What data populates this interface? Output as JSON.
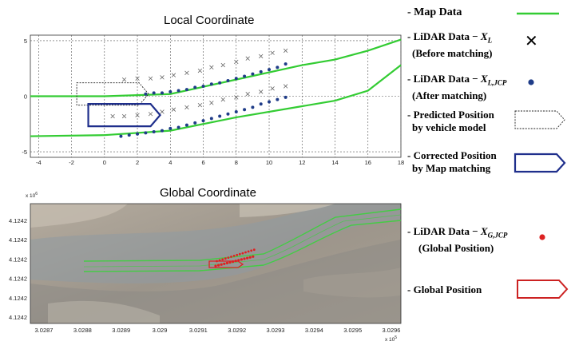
{
  "chart_data": [
    {
      "type": "line",
      "title": "Local Coordinate",
      "xlim": [
        -4.5,
        18
      ],
      "ylim": [
        -5.5,
        5.5
      ],
      "x_ticks": [
        -4,
        -2,
        0,
        2,
        4,
        6,
        8,
        10,
        12,
        14,
        16,
        18
      ],
      "y_ticks": [
        5,
        0,
        -5
      ],
      "grid": true,
      "series": [
        {
          "name": "Map Data",
          "style": "line",
          "color": "#33cc33",
          "lines": [
            [
              [
                -4.5,
                0.0
              ],
              [
                0,
                0.0
              ],
              [
                4,
                0.2
              ],
              [
                8,
                1.5
              ],
              [
                12,
                2.8
              ],
              [
                14,
                3.3
              ],
              [
                16,
                4.1
              ],
              [
                18,
                5.1
              ]
            ],
            [
              [
                -4.5,
                -3.6
              ],
              [
                0,
                -3.5
              ],
              [
                4,
                -3.1
              ],
              [
                8,
                -1.9
              ],
              [
                12,
                -0.9
              ],
              [
                14,
                -0.4
              ],
              [
                16,
                0.5
              ],
              [
                18,
                2.8
              ]
            ]
          ]
        },
        {
          "name": "LiDAR Data - X_L (Before matching)",
          "style": "cross",
          "color": "#666666",
          "points": [
            [
              1.2,
              1.5
            ],
            [
              2,
              1.6
            ],
            [
              2.8,
              1.6
            ],
            [
              3.5,
              1.7
            ],
            [
              4.2,
              1.9
            ],
            [
              5,
              2.1
            ],
            [
              5.8,
              2.3
            ],
            [
              6.5,
              2.6
            ],
            [
              7.2,
              2.8
            ],
            [
              8,
              3.1
            ],
            [
              8.7,
              3.4
            ],
            [
              9.5,
              3.6
            ],
            [
              10.2,
              3.9
            ],
            [
              11,
              4.1
            ],
            [
              0.5,
              -1.8
            ],
            [
              1.2,
              -1.8
            ],
            [
              2,
              -1.7
            ],
            [
              2.8,
              -1.6
            ],
            [
              3.5,
              -1.4
            ],
            [
              4.2,
              -1.2
            ],
            [
              5,
              -1.0
            ],
            [
              5.8,
              -0.8
            ],
            [
              6.5,
              -0.6
            ],
            [
              7.2,
              -0.3
            ],
            [
              8,
              -0.1
            ],
            [
              8.7,
              0.2
            ],
            [
              9.5,
              0.4
            ],
            [
              10.2,
              0.7
            ],
            [
              11,
              0.9
            ]
          ]
        },
        {
          "name": "LiDAR Data - X_L,JCP (After matching)",
          "style": "dot",
          "color": "#1f3c88",
          "points": [
            [
              2.5,
              0.2
            ],
            [
              3,
              0.3
            ],
            [
              3.5,
              0.3
            ],
            [
              4,
              0.4
            ],
            [
              4.5,
              0.5
            ],
            [
              5,
              0.6
            ],
            [
              5.5,
              0.8
            ],
            [
              6,
              0.9
            ],
            [
              6.5,
              1.1
            ],
            [
              7,
              1.2
            ],
            [
              7.5,
              1.4
            ],
            [
              8,
              1.6
            ],
            [
              8.5,
              1.8
            ],
            [
              9,
              2.0
            ],
            [
              9.5,
              2.2
            ],
            [
              10,
              2.4
            ],
            [
              10.5,
              2.6
            ],
            [
              11,
              2.9
            ],
            [
              1,
              -3.6
            ],
            [
              1.5,
              -3.5
            ],
            [
              2,
              -3.4
            ],
            [
              2.5,
              -3.3
            ],
            [
              3,
              -3.2
            ],
            [
              3.5,
              -3.1
            ],
            [
              4,
              -2.9
            ],
            [
              4.5,
              -2.8
            ],
            [
              5,
              -2.6
            ],
            [
              5.5,
              -2.4
            ],
            [
              6,
              -2.2
            ],
            [
              6.5,
              -2.0
            ],
            [
              7,
              -1.8
            ],
            [
              7.5,
              -1.6
            ],
            [
              8,
              -1.4
            ],
            [
              8.5,
              -1.2
            ],
            [
              9,
              -1.0
            ],
            [
              9.5,
              -0.7
            ],
            [
              10,
              -0.5
            ],
            [
              10.5,
              -0.3
            ],
            [
              11,
              -0.1
            ]
          ]
        },
        {
          "name": "Predicted Position by vehicle model",
          "style": "dashed-outline",
          "color": "#222222",
          "center": [
            0.5,
            0.2
          ]
        },
        {
          "name": "Corrected Position by Map matching",
          "style": "outline",
          "color": "#1f2f8c",
          "center": [
            1.2,
            -1.7
          ]
        }
      ]
    },
    {
      "type": "scatter",
      "title": "Global Coordinate",
      "background": "satellite-image",
      "x_ticks": [
        "3.0287",
        "3.0288",
        "3.0289",
        "3.029",
        "3.0291",
        "3.0292",
        "3.0293",
        "3.0294",
        "3.0295",
        "3.0296"
      ],
      "y_ticks": [
        "4.1242",
        "4.1242",
        "4.1242",
        "4.1242",
        "4.1242",
        "4.1242"
      ],
      "x_exponent": "x 10",
      "x_exponent_power": "5",
      "y_exponent": "x 10",
      "y_exponent_power": "6",
      "series": [
        {
          "name": "Map Data",
          "style": "line",
          "color": "#33cc33"
        },
        {
          "name": "LiDAR Data - X_G,JCP (Global Position)",
          "style": "dot",
          "color": "#dd2222"
        },
        {
          "name": "Global Position",
          "style": "outline",
          "color": "#cc2222"
        }
      ]
    }
  ],
  "legend": {
    "map_data": "- Map Data",
    "lidar_before_1": "LiDAR Data − ",
    "lidar_before_sym": "X",
    "lidar_before_sub": "L",
    "lidar_before_2": "(Before matching)",
    "lidar_after_1": "LiDAR Data − ",
    "lidar_after_sym": "X",
    "lidar_after_sub": "L,JCP",
    "lidar_after_2": "(After matching)",
    "predicted_1": "Predicted Position",
    "predicted_2": "by vehicle model",
    "corrected_1": "Corrected Position",
    "corrected_2": "by Map matching",
    "global_lidar_1": "LiDAR Data − ",
    "global_lidar_sym": "X",
    "global_lidar_sub": "G,JCP",
    "global_lidar_2": "(Global Position)",
    "global_position": "- Global Position",
    "dash": "-"
  },
  "colors": {
    "map_line": "#33cc33",
    "lidar_after": "#1f3c88",
    "corrected": "#1f2f8c",
    "global_red": "#dd2222"
  }
}
